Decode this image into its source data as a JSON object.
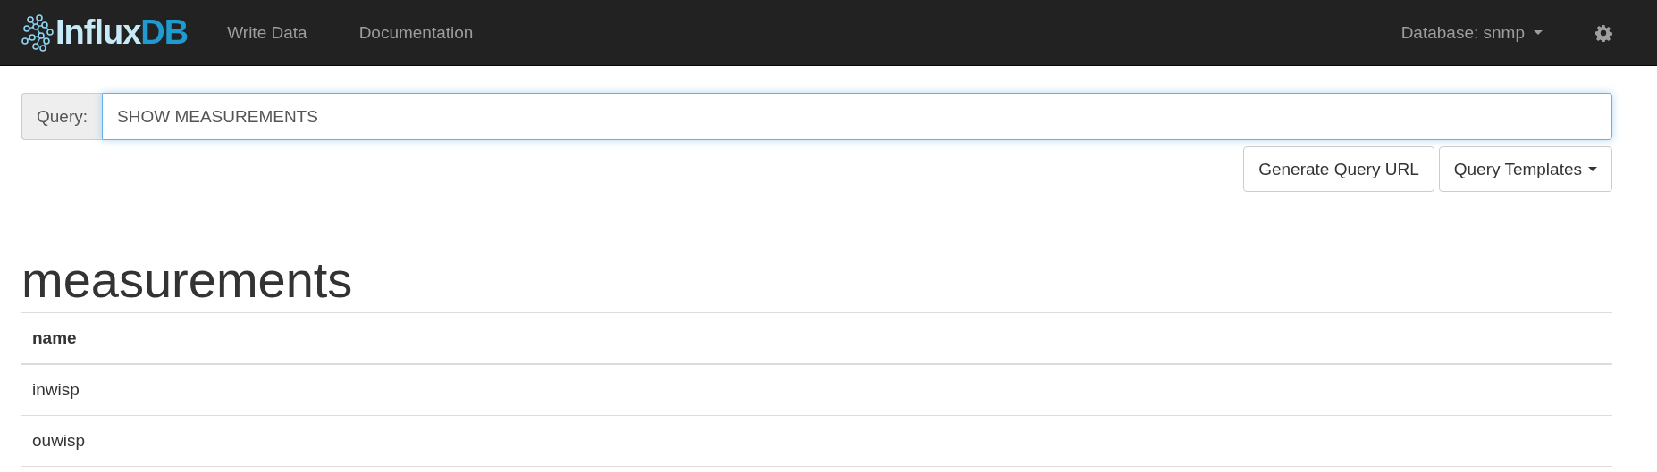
{
  "navbar": {
    "logo": {
      "light": "Influx",
      "dark": "DB"
    },
    "links": [
      "Write Data",
      "Documentation"
    ],
    "database": "Database: snmp"
  },
  "query": {
    "label": "Query:",
    "value": "SHOW MEASUREMENTS"
  },
  "buttons": [
    {
      "label": "Generate Query URL",
      "dropdown": false
    },
    {
      "label": "Query Templates",
      "dropdown": true
    }
  ],
  "result": {
    "title": "measurements",
    "columns": [
      "name"
    ],
    "rows": [
      [
        "inwisp"
      ],
      [
        "ouwisp"
      ]
    ]
  }
}
